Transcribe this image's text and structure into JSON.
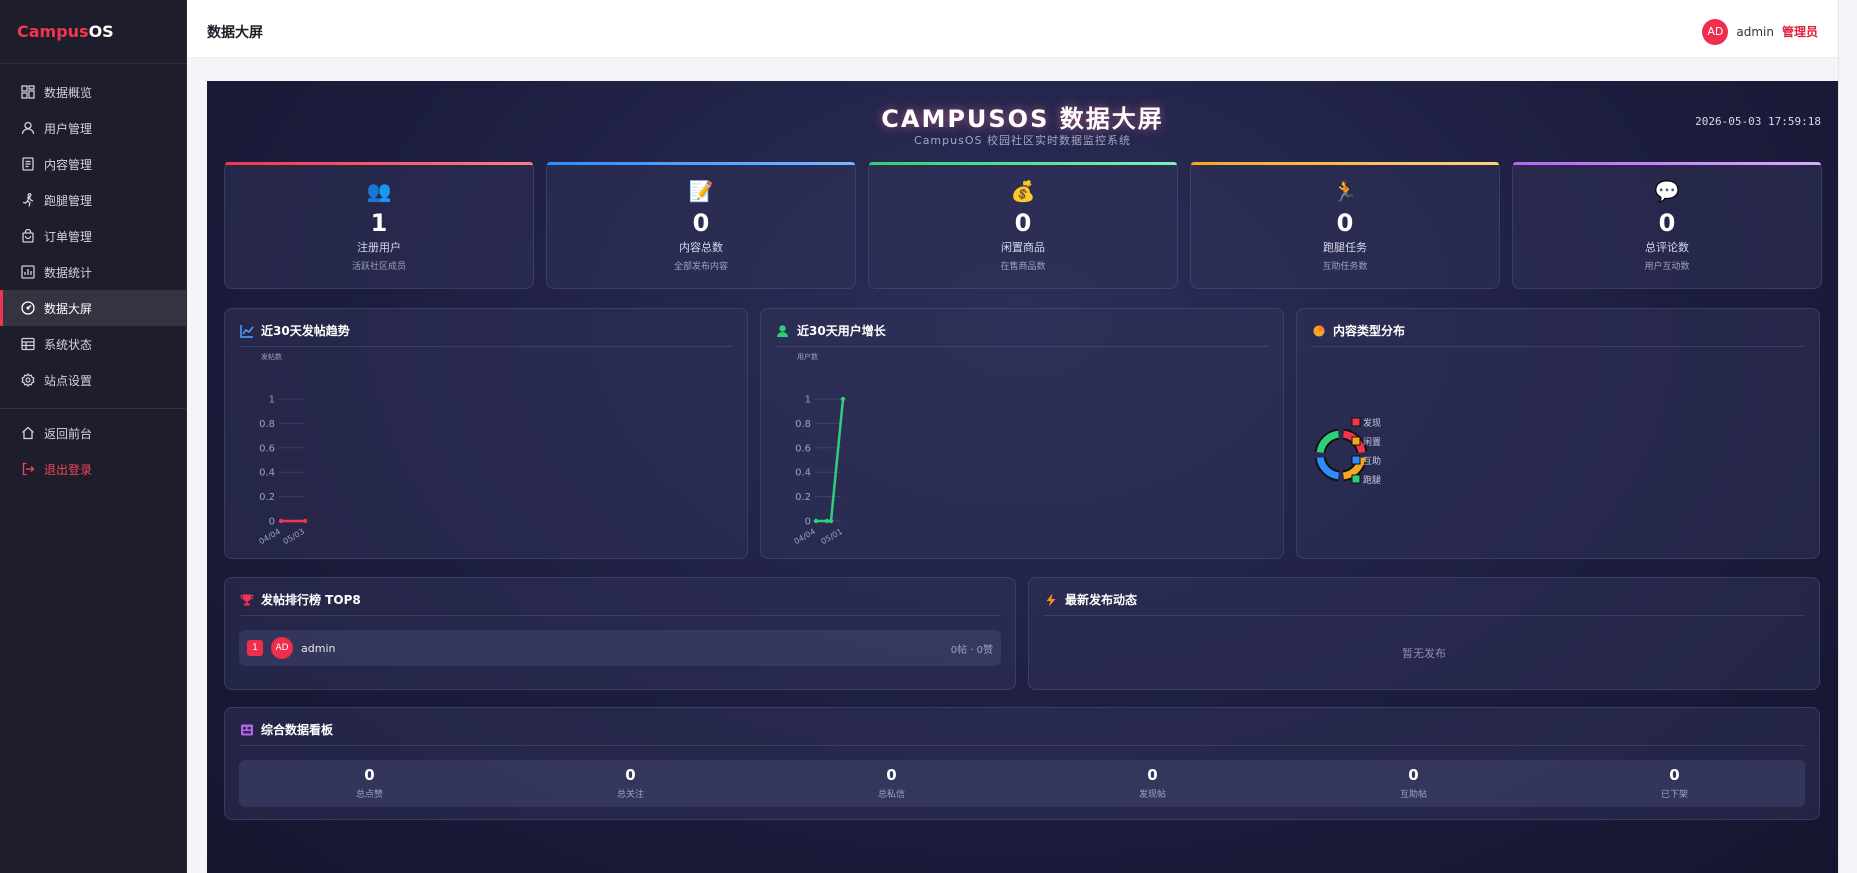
{
  "brand": {
    "part1": "Campus",
    "part2": "OS"
  },
  "sidebar": {
    "items": [
      {
        "label": "数据概览",
        "icon": "dashboard-grid-icon"
      },
      {
        "label": "用户管理",
        "icon": "user-icon"
      },
      {
        "label": "内容管理",
        "icon": "document-icon"
      },
      {
        "label": "跑腿管理",
        "icon": "runner-icon"
      },
      {
        "label": "订单管理",
        "icon": "bag-icon"
      },
      {
        "label": "数据统计",
        "icon": "bar-chart-icon"
      },
      {
        "label": "数据大屏",
        "icon": "gauge-icon",
        "active": true
      },
      {
        "label": "系统状态",
        "icon": "server-icon"
      },
      {
        "label": "站点设置",
        "icon": "gear-icon"
      }
    ],
    "back": {
      "label": "返回前台",
      "icon": "home-icon"
    },
    "logout": {
      "label": "退出登录",
      "icon": "logout-icon"
    }
  },
  "header": {
    "title": "数据大屏",
    "avatar": "AD",
    "username": "admin",
    "role": "管理员"
  },
  "screen": {
    "title": "CAMPUSOS 数据大屏",
    "subtitle": "CampusOS 校园社区实时数据监控系统",
    "time": "2026-05-03 17:59:18"
  },
  "stats": [
    {
      "icon": "👥",
      "value": "1",
      "label": "注册用户",
      "sub": "活跃社区成员",
      "color": "#f0364f"
    },
    {
      "icon": "📝",
      "value": "0",
      "label": "内容总数",
      "sub": "全部发布内容",
      "color": "#2f8cff"
    },
    {
      "icon": "💰",
      "value": "0",
      "label": "闲置商品",
      "sub": "在售商品数",
      "color": "#2ecf7a"
    },
    {
      "icon": "🏃",
      "value": "0",
      "label": "跑腿任务",
      "sub": "互助任务数",
      "color": "#f6a623"
    },
    {
      "icon": "💬",
      "value": "0",
      "label": "总评论数",
      "sub": "用户互动数",
      "color": "#b565f0"
    }
  ],
  "panels": {
    "posts_trend": {
      "title": "近30天发帖趋势"
    },
    "user_growth": {
      "title": "近30天用户增长"
    },
    "content_dist": {
      "title": "内容类型分布"
    },
    "ranking": {
      "title": "发帖排行榜 TOP8",
      "rows": [
        {
          "rank": "1",
          "avatar": "AD",
          "name": "admin",
          "stat": "0帖 · 0赞"
        }
      ]
    },
    "latest": {
      "title": "最新发布动态",
      "empty": "暂无发布"
    },
    "summary": {
      "title": "综合数据看板",
      "cells": [
        {
          "value": "0",
          "label": "总点赞"
        },
        {
          "value": "0",
          "label": "总关注"
        },
        {
          "value": "0",
          "label": "总私信"
        },
        {
          "value": "0",
          "label": "发现帖"
        },
        {
          "value": "0",
          "label": "互助帖"
        },
        {
          "value": "0",
          "label": "已下架"
        }
      ]
    }
  },
  "chart_data": [
    {
      "type": "line",
      "title": "近30天发帖趋势",
      "ylabel": "发帖数",
      "x": [
        "04/04",
        "05/03"
      ],
      "series": [
        {
          "values": [
            0,
            0
          ]
        }
      ],
      "ylim": [
        0,
        1
      ],
      "yticks": [
        "0",
        "0.2",
        "0.4",
        "0.6",
        "0.8",
        "1"
      ],
      "color": "#f0364f"
    },
    {
      "type": "line",
      "title": "近30天用户增长",
      "ylabel": "用户数",
      "x": [
        "04/04",
        "05/01",
        "05/02",
        "05/03"
      ],
      "series": [
        {
          "values": [
            0,
            0,
            0,
            1
          ]
        }
      ],
      "ylim": [
        0,
        1
      ],
      "yticks": [
        "0",
        "0.2",
        "0.4",
        "0.6",
        "0.8",
        "1"
      ],
      "xticks": [
        "04/04",
        "05/01"
      ],
      "color": "#2ecf7a"
    },
    {
      "type": "pie",
      "title": "内容类型分布",
      "legend": [
        "发现",
        "闲置",
        "互助",
        "跑腿"
      ],
      "colors": [
        "#f0364f",
        "#f6a623",
        "#2f8cff",
        "#2ecf7a"
      ]
    }
  ]
}
